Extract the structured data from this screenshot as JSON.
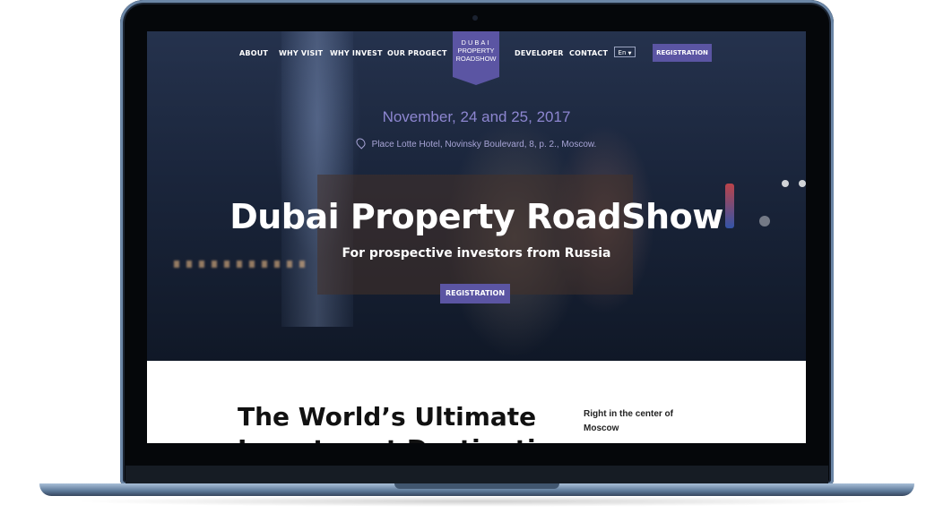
{
  "nav": {
    "about": "ABOUT",
    "why_visit": "WHY VISIT",
    "why_invest": "WHY INVEST",
    "our_project": "OUR PROGECT",
    "developer": "DEVELOPER",
    "contact": "CONTACT",
    "language": "En",
    "registration": "REGISTRATION"
  },
  "logo": {
    "line1": "DUBAI",
    "line2": "PROPERTY",
    "line3": "ROADSHOW"
  },
  "hero": {
    "date": "November, 24 and 25, 2017",
    "location": "Place Lotte Hotel, Novinsky Boulevard, 8, p. 2., Moscow.",
    "title": "Dubai Property RoadShow",
    "subtitle": "For prospective investors from Russia",
    "registration": "REGISTRATION"
  },
  "section": {
    "title_line1": "The World’s Ultimate",
    "title_line2": "Investment Destinati",
    "side_text": "Right in the center of Moscow"
  },
  "colors": {
    "accent": "#5b55a3",
    "date_text": "#8d86d0"
  },
  "icons": {
    "location": "location-pin-icon",
    "dropdown": "chevron-down-icon"
  }
}
